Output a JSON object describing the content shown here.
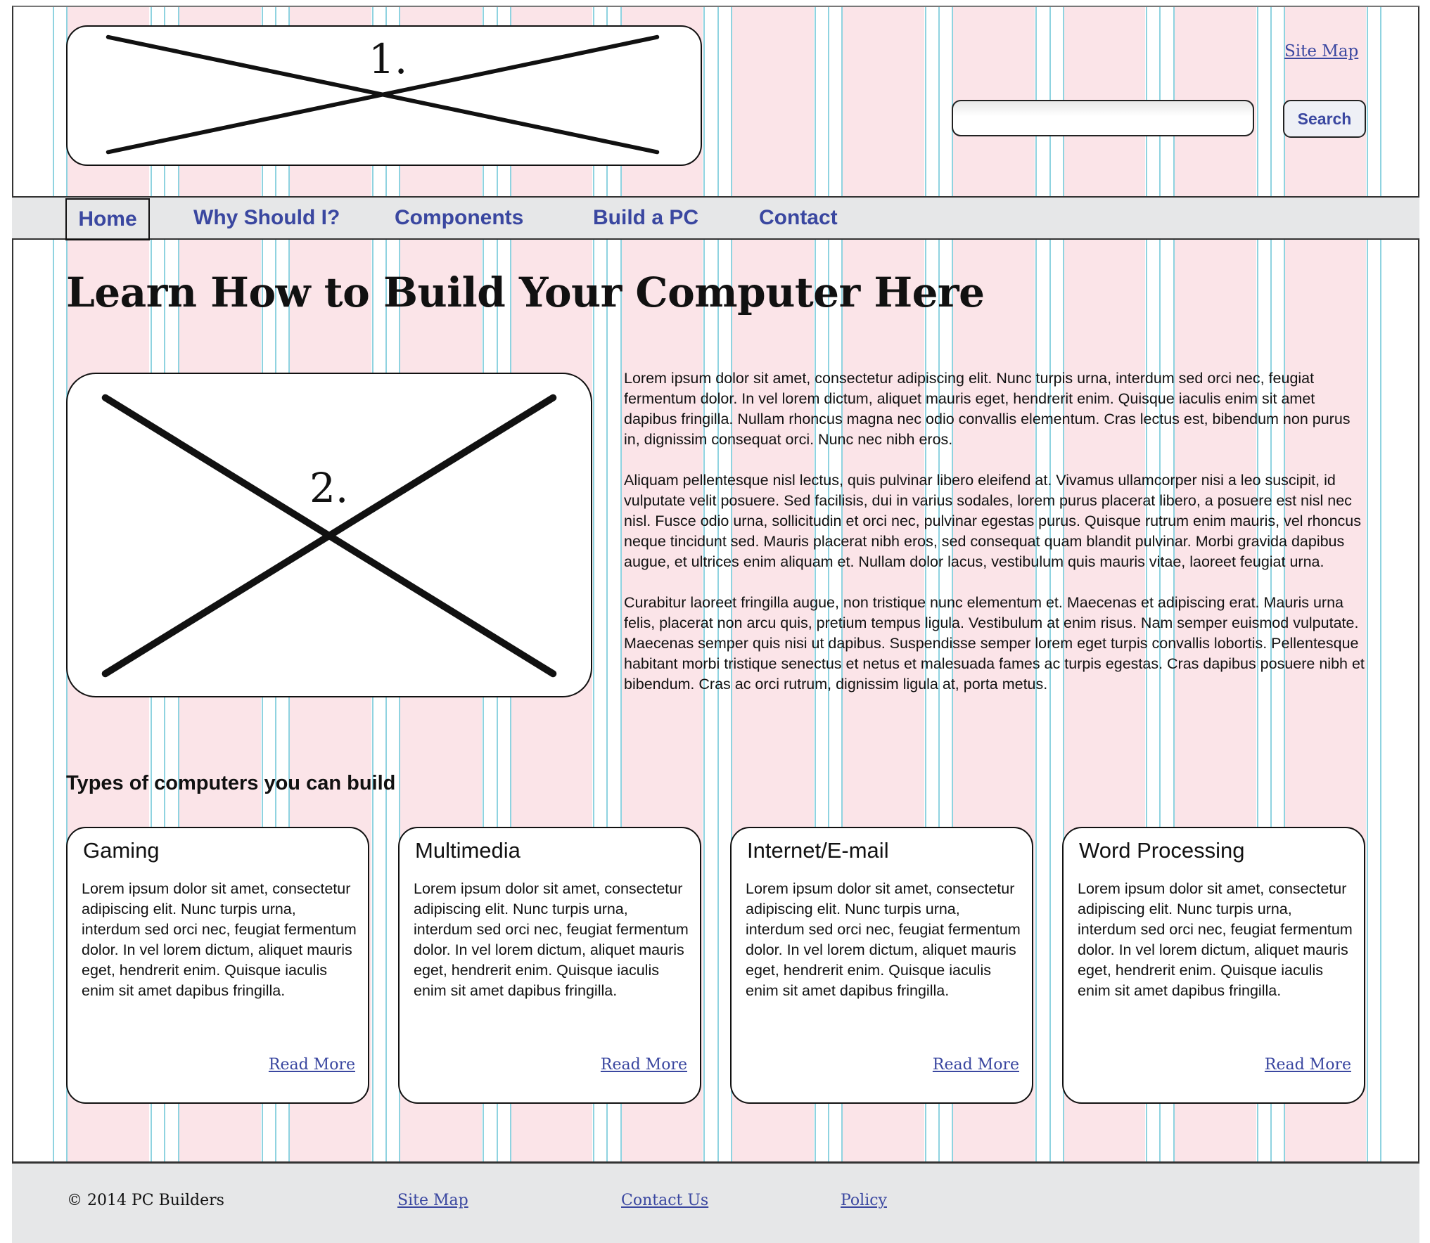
{
  "header": {
    "logo_placeholder_label": "1.",
    "site_map_link": "Site Map",
    "search": {
      "placeholder": "",
      "value": "",
      "button_label": "Search"
    }
  },
  "nav": {
    "items": [
      {
        "label": "Home",
        "selected": true
      },
      {
        "label": "Why Should I?"
      },
      {
        "label": "Components"
      },
      {
        "label": "Build a PC"
      },
      {
        "label": "Contact"
      }
    ]
  },
  "main": {
    "title": "Learn How to Build Your Computer Here",
    "hero_placeholder_label": "2.",
    "paragraphs": [
      "Lorem ipsum dolor sit amet, consectetur adipiscing elit. Nunc turpis urna, interdum sed orci nec, feugiat fermentum dolor. In vel lorem dictum, aliquet mauris eget, hendrerit enim. Quisque iaculis enim sit amet dapibus fringilla. Nullam rhoncus magna nec odio convallis elementum. Cras lectus est, bibendum non purus in, dignissim consequat orci. Nunc nec nibh eros.",
      "Aliquam pellentesque nisl lectus, quis pulvinar libero eleifend at. Vivamus ullamcorper nisi a leo suscipit, id vulputate velit posuere. Sed facilisis, dui in varius sodales, lorem purus placerat libero, a posuere est nisl nec nisl. Fusce odio urna, sollicitudin et orci nec, pulvinar egestas purus. Quisque rutrum enim mauris, vel rhoncus neque tincidunt sed. Mauris placerat nibh eros, sed consequat quam blandit pulvinar. Morbi gravida dapibus augue, et ultrices enim aliquam et. Nullam dolor lacus, vestibulum quis mauris vitae, laoreet feugiat urna.",
      "Curabitur laoreet fringilla augue, non tristique nunc elementum et. Maecenas et adipiscing erat. Mauris urna felis, placerat non arcu quis, pretium tempus ligula. Vestibulum at enim risus. Nam semper euismod vulputate. Maecenas semper quis nisi ut dapibus. Suspendisse semper lorem eget turpis convallis lobortis. Pellentesque habitant morbi tristique senectus et netus et malesuada fames ac turpis egestas. Cras dapibus posuere nibh et bibendum. Cras ac orci rutrum, dignissim ligula at, porta metus."
    ],
    "section_heading": "Types of computers you can build",
    "cards": [
      {
        "title": "Gaming",
        "text": "Lorem ipsum dolor sit amet, consectetur adipiscing elit. Nunc turpis urna, interdum sed orci nec, feugiat fermentum dolor. In vel lorem dictum, aliquet mauris eget, hendrerit enim. Quisque iaculis enim sit amet dapibus fringilla.",
        "link": "Read More"
      },
      {
        "title": "Multimedia",
        "text": "Lorem ipsum dolor sit amet, consectetur adipiscing elit. Nunc turpis urna, interdum sed orci nec, feugiat fermentum dolor. In vel lorem dictum, aliquet mauris eget, hendrerit enim. Quisque iaculis enim sit amet dapibus fringilla.",
        "link": "Read More"
      },
      {
        "title": "Internet/E-mail",
        "text": "Lorem ipsum dolor sit amet, consectetur adipiscing elit. Nunc turpis urna, interdum sed orci nec, feugiat fermentum dolor. In vel lorem dictum, aliquet mauris eget, hendrerit enim. Quisque iaculis enim sit amet dapibus fringilla.",
        "link": "Read More"
      },
      {
        "title": "Word Processing",
        "text": "Lorem ipsum dolor sit amet, consectetur adipiscing elit. Nunc turpis urna, interdum sed orci nec, feugiat fermentum dolor. In vel lorem dictum, aliquet mauris eget, hendrerit enim. Quisque iaculis enim sit amet dapibus fringilla.",
        "link": "Read More"
      }
    ]
  },
  "footer": {
    "copyright": "© 2014 PC Builders",
    "links": [
      "Site Map",
      "Contact Us",
      "Policy"
    ]
  },
  "colors": {
    "link": "#3a47a0",
    "grid_column": "#fbe4e8",
    "grid_line": "#8fd3e0",
    "bar_background": "#e6e7e8"
  }
}
